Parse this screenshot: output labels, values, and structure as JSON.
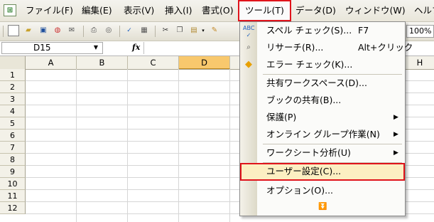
{
  "menubar": {
    "items": [
      {
        "label": "ファイル(F)"
      },
      {
        "label": "編集(E)"
      },
      {
        "label": "表示(V)"
      },
      {
        "label": "挿入(I)"
      },
      {
        "label": "書式(O)"
      },
      {
        "label": "ツール(T)"
      },
      {
        "label": "データ(D)"
      },
      {
        "label": "ウィンドウ(W)"
      },
      {
        "label": "ヘルプ"
      }
    ]
  },
  "toolbar": {
    "zoom": "100%"
  },
  "formula": {
    "cell_ref": "D15",
    "fx": "fx"
  },
  "grid": {
    "columns": [
      "A",
      "B",
      "C",
      "D"
    ],
    "selected_column": "D",
    "rows": [
      "1",
      "2",
      "3",
      "4",
      "5",
      "6",
      "7",
      "8",
      "9",
      "10",
      "11",
      "12"
    ],
    "right_col": "H"
  },
  "tools_menu": {
    "items": [
      {
        "label": "スペル チェック(S)...",
        "shortcut": "F7",
        "icon": "spell-check-icon"
      },
      {
        "label": "リサーチ(R)...",
        "shortcut": "Alt+クリック",
        "icon": "research-icon"
      },
      {
        "label": "エラー チェック(K)...",
        "icon": "error-check-icon"
      },
      {
        "label": "共有ワークスペース(D)..."
      },
      {
        "label": "ブックの共有(B)..."
      },
      {
        "label": "保護(P)",
        "submenu": true
      },
      {
        "label": "オンライン グループ作業(N)",
        "submenu": true
      },
      {
        "label": "ワークシート分析(U)",
        "submenu": true
      },
      {
        "label": "ユーザー設定(C)...",
        "highlighted": true
      },
      {
        "label": "オプション(O)..."
      }
    ]
  },
  "colors": {
    "highlight_border": "#e0141c",
    "selected_header": "#f8c86d",
    "highlight_fill": "#fcefc2"
  }
}
